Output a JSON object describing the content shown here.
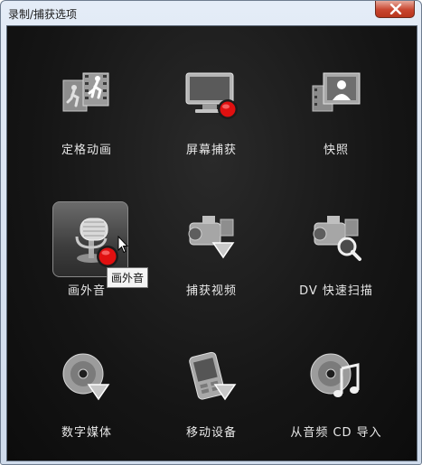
{
  "window": {
    "title": "录制/捕获选项"
  },
  "tiles": [
    {
      "label": "定格动画",
      "icon": "stop-motion-film-icon"
    },
    {
      "label": "屏幕捕获",
      "icon": "screen-capture-monitor-icon"
    },
    {
      "label": "快照",
      "icon": "snapshot-photo-icon"
    },
    {
      "label": "画外音",
      "icon": "voiceover-microphone-icon"
    },
    {
      "label": "捕获视频",
      "icon": "capture-video-camera-icon"
    },
    {
      "label": "DV 快速扫描",
      "icon": "dv-quick-scan-icon"
    },
    {
      "label": "数字媒体",
      "icon": "digital-media-disc-icon"
    },
    {
      "label": "移动设备",
      "icon": "mobile-device-icon"
    },
    {
      "label": "从音频 CD 导入",
      "icon": "audio-cd-import-icon"
    }
  ],
  "tooltip": {
    "text": "画外音"
  },
  "colors": {
    "record_red": "#e01010",
    "panel_bg": "#151515"
  }
}
